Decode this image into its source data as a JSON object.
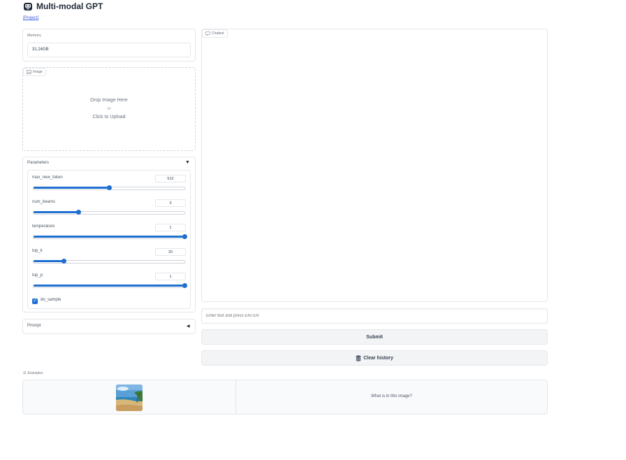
{
  "app": {
    "title": "Multi-modal GPT",
    "project_link": "[Project]"
  },
  "memory": {
    "label": "Memory",
    "value": "31.24GB"
  },
  "image_upload": {
    "tag": "Image",
    "drop_line1": "Drop Image Here",
    "drop_or": "or",
    "drop_line2": "Click to Upload"
  },
  "parameters": {
    "title": "Parameters",
    "sliders": [
      {
        "name": "max_new_token",
        "value": "512",
        "fraction": 0.5
      },
      {
        "name": "num_beams",
        "value": "3",
        "fraction": 0.3
      },
      {
        "name": "temperature",
        "value": "1",
        "fraction": 1.0
      },
      {
        "name": "top_k",
        "value": "20",
        "fraction": 0.2
      },
      {
        "name": "top_p",
        "value": "1",
        "fraction": 1.0
      }
    ],
    "do_sample": {
      "label": "do_sample",
      "checked": true
    }
  },
  "prompt": {
    "title": "Prompt"
  },
  "chatbot": {
    "tag": "Chatbot"
  },
  "input": {
    "placeholder": "Enter text and press ENTER"
  },
  "buttons": {
    "submit": "Submit",
    "clear": "Clear history"
  },
  "examples": {
    "label": "Examples",
    "text": "What is in this image?"
  },
  "colors": {
    "accent": "#1f6fd0",
    "border": "#e5e7eb",
    "button_bg": "#f3f4f6"
  }
}
